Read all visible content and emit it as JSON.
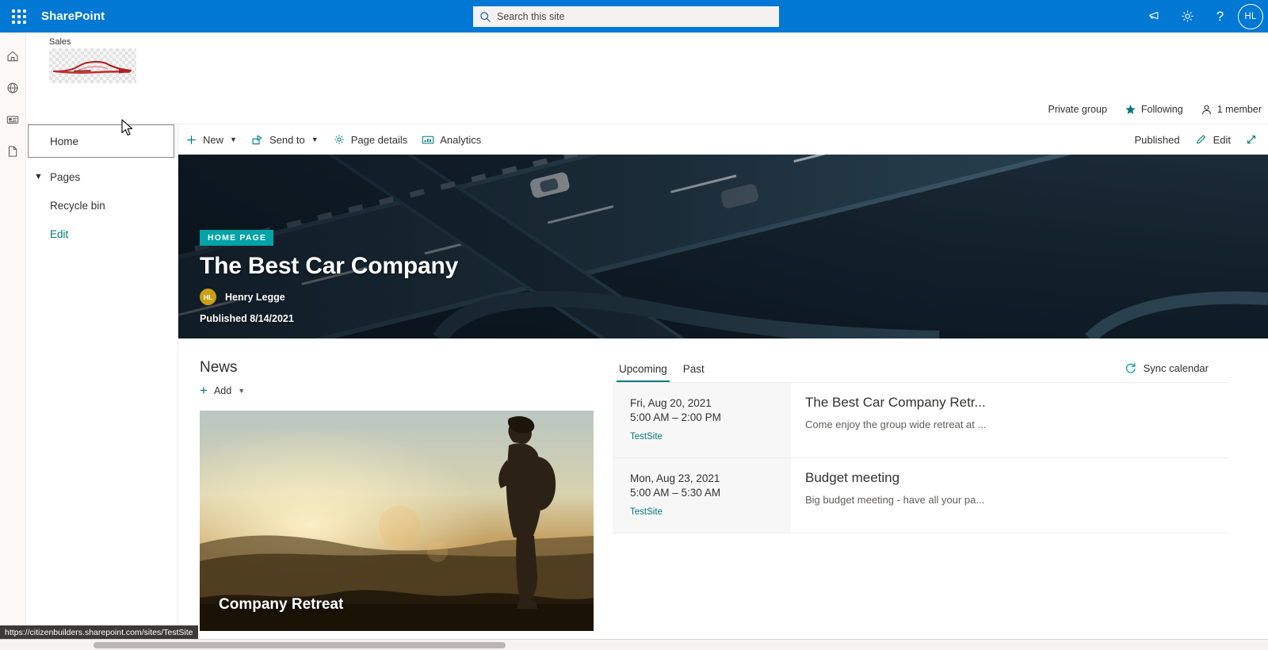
{
  "suite": {
    "brand": "SharePoint",
    "waffle_icon": "app-launcher-waffle-icon",
    "search": {
      "placeholder": "Search this site",
      "value": "",
      "icon": "search-icon"
    },
    "icons": [
      {
        "name": "megaphone-icon",
        "label": "Feedback"
      },
      {
        "name": "gear-icon",
        "label": "Settings"
      },
      {
        "name": "help-icon",
        "label": "?"
      }
    ],
    "avatar_initials": "HL"
  },
  "rail": {
    "items": [
      {
        "name": "home-icon",
        "label": "Home"
      },
      {
        "name": "globe-icon",
        "label": "Sites"
      },
      {
        "name": "news-icon",
        "label": "News"
      },
      {
        "name": "document-icon",
        "label": "Files"
      }
    ]
  },
  "site": {
    "logo_label": "Sales",
    "logo_alt": "red-car-sketch-logo"
  },
  "site_meta": {
    "privacy": "Private group",
    "following": "Following",
    "following_icon": "star-icon",
    "members": "1 member",
    "members_icon": "person-icon"
  },
  "command_bar": {
    "items": [
      {
        "label": "New",
        "icon": "plus-icon",
        "has_chevron": true
      },
      {
        "label": "Send to",
        "icon": "share-icon",
        "has_chevron": true
      },
      {
        "label": "Page details",
        "icon": "gear-icon",
        "has_chevron": false
      },
      {
        "label": "Analytics",
        "icon": "analytics-icon",
        "has_chevron": false
      }
    ],
    "status": "Published",
    "edit_label": "Edit",
    "edit_icon": "pencil-icon",
    "expand_icon": "expand-diagonal-icon"
  },
  "left_nav": {
    "items": [
      {
        "label": "Home",
        "state": "focused",
        "has_chevron": false
      },
      {
        "label": "Pages",
        "state": "normal",
        "has_chevron": true
      },
      {
        "label": "Recycle bin",
        "state": "normal",
        "has_chevron": false
      },
      {
        "label": "Edit",
        "state": "link",
        "has_chevron": false
      }
    ]
  },
  "hero": {
    "badge": "HOME PAGE",
    "title": "The Best Car Company",
    "author_initials": "HL",
    "author_name": "Henry Legge",
    "published": "Published 8/14/2021",
    "image_alt": "aerial-highway-interchange-photo"
  },
  "news": {
    "title": "News",
    "add_label": "Add",
    "add_icon": "plus-icon",
    "add_chevron": "chevron-down-icon",
    "cards": [
      {
        "title": "Company Retreat",
        "image_alt": "hiker-sunset-mountain-photo"
      }
    ]
  },
  "events": {
    "tabs": [
      {
        "label": "Upcoming",
        "active": true
      },
      {
        "label": "Past",
        "active": false
      }
    ],
    "sync_label": "Sync calendar",
    "sync_icon": "refresh-icon",
    "items": [
      {
        "date": "Fri, Aug 20, 2021",
        "time": "5:00 AM – 2:00 PM",
        "site": "TestSite",
        "title": "The Best Car Company Retr...",
        "description": "Come enjoy the group wide retreat at ..."
      },
      {
        "date": "Mon, Aug 23, 2021",
        "time": "5:00 AM – 5:30 AM",
        "site": "TestSite",
        "title": "Budget meeting",
        "description": "Big budget meeting - have all your pa..."
      }
    ]
  },
  "status_bar": {
    "url": "https://citizenbuilders.sharepoint.com/sites/TestSite"
  },
  "colors": {
    "brand_blue": "#0078d4",
    "teal": "#03787c",
    "badge_teal": "#03a3a8",
    "avatar_gold": "#c8a014",
    "text": "#323130"
  }
}
